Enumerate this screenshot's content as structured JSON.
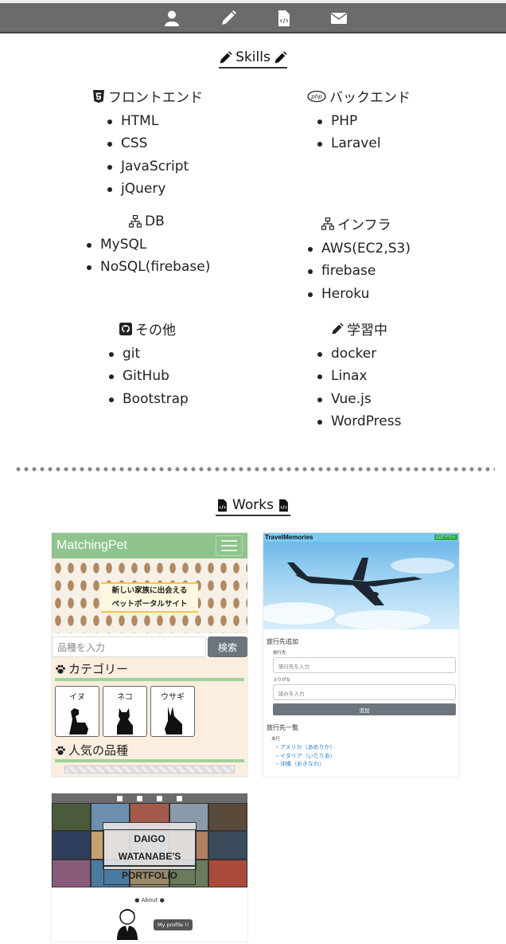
{
  "nav": {
    "items": [
      {
        "icon": "user-icon"
      },
      {
        "icon": "pencil-icon"
      },
      {
        "icon": "code-file-icon"
      },
      {
        "icon": "envelope-icon"
      }
    ]
  },
  "skills": {
    "title": "Skills",
    "groups": [
      {
        "heading": "フロントエンド",
        "icon": "html5-icon",
        "items": [
          "HTML",
          "CSS",
          "JavaScript",
          "jQuery"
        ]
      },
      {
        "heading": "バックエンド",
        "icon": "php-icon",
        "items": [
          "PHP",
          "Laravel"
        ]
      },
      {
        "heading": "DB",
        "icon": "sitemap-icon",
        "items": [
          "MySQL",
          "NoSQL(firebase)"
        ]
      },
      {
        "heading": "インフラ",
        "icon": "sitemap-icon",
        "items": [
          "AWS(EC2,S3)",
          "firebase",
          "Heroku"
        ]
      },
      {
        "heading": "その他",
        "icon": "github-icon",
        "items": [
          "git",
          "GitHub",
          "Bootstrap"
        ]
      },
      {
        "heading": "学習中",
        "icon": "pencil-icon",
        "items": [
          "docker",
          "Linax",
          "Vue.js",
          "WordPress"
        ]
      }
    ]
  },
  "works": {
    "title": "Works",
    "matchingpet": {
      "logo": "MatchingPet",
      "hero_line1": "新しい家族に出会える",
      "hero_line2": "ペットポータルサイト",
      "search_placeholder": "品種を入力",
      "search_button": "検索",
      "category_heading": "カテゴリー",
      "cards": [
        "イヌ",
        "ネコ",
        "ウサギ"
      ],
      "popular_heading": "人気の品種"
    },
    "travelmemories": {
      "logo": "TravelMemories",
      "login": "ログアウト",
      "add_heading": "旅行先追加",
      "dest_label": "旅行先",
      "dest_placeholder": "旅行先を入力",
      "reading_label": "ふりがな",
      "reading_placeholder": "読みを入力",
      "add_button": "追加",
      "list_heading": "旅行先一覧",
      "group_label": "あ行",
      "entries": [
        "・アメリカ（あめりか）",
        "・イタリア（いたりあ）",
        "・沖縄（おきなわ）"
      ]
    },
    "portfolio": {
      "title_line1": "DAIGO WATANABE'S",
      "title_line2": "PORTFOLIO",
      "about": "About",
      "bubble": "My profile !!"
    }
  }
}
